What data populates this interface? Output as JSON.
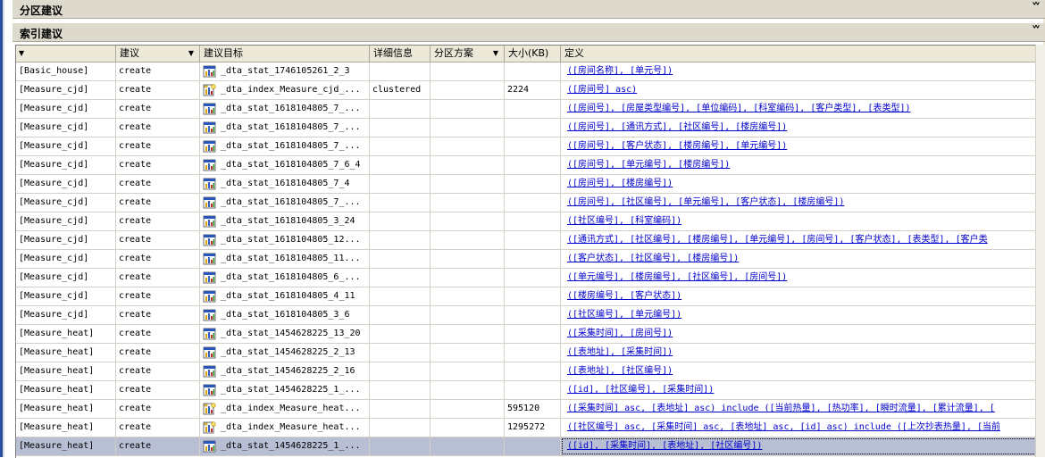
{
  "sections": {
    "partition": {
      "title": "分区建议",
      "chevron": "»"
    },
    "index": {
      "title": "索引建议",
      "chevron": "»"
    }
  },
  "columns": [
    {
      "label": "",
      "sort_icon": "▼"
    },
    {
      "label": "建议",
      "sort_icon": "▼"
    },
    {
      "label": "建议目标",
      "sort_icon": ""
    },
    {
      "label": "详细信息",
      "sort_icon": ""
    },
    {
      "label": "分区方案",
      "sort_icon": "▼"
    },
    {
      "label": "大小(KB)",
      "sort_icon": ""
    },
    {
      "label": "定义",
      "sort_icon": ""
    }
  ],
  "rows": [
    {
      "table": "[Basic_house]",
      "action": "create",
      "icon": "statistics-icon",
      "target": "_dta_stat_1746105261_2_3",
      "detail": "",
      "scheme": "",
      "size": "",
      "definition": "([房间名称], [单元号])",
      "selected": false
    },
    {
      "table": "[Measure_cjd]",
      "action": "create",
      "icon": "index-icon",
      "target": "_dta_index_Measure_cjd_...",
      "detail": "clustered",
      "scheme": "",
      "size": "2224",
      "definition": "([房间号] asc)",
      "selected": false
    },
    {
      "table": "[Measure_cjd]",
      "action": "create",
      "icon": "statistics-icon",
      "target": "_dta_stat_1618104805_7_...",
      "detail": "",
      "scheme": "",
      "size": "",
      "definition": "([房间号], [房屋类型编号], [单位编码], [科室编码], [客户类型], [表类型])",
      "selected": false
    },
    {
      "table": "[Measure_cjd]",
      "action": "create",
      "icon": "statistics-icon",
      "target": "_dta_stat_1618104805_7_...",
      "detail": "",
      "scheme": "",
      "size": "",
      "definition": "([房间号], [通讯方式], [社区编号], [楼房编号])",
      "selected": false
    },
    {
      "table": "[Measure_cjd]",
      "action": "create",
      "icon": "statistics-icon",
      "target": "_dta_stat_1618104805_7_...",
      "detail": "",
      "scheme": "",
      "size": "",
      "definition": "([房间号], [客户状态], [楼房编号], [单元编号])",
      "selected": false
    },
    {
      "table": "[Measure_cjd]",
      "action": "create",
      "icon": "statistics-icon",
      "target": "_dta_stat_1618104805_7_6_4",
      "detail": "",
      "scheme": "",
      "size": "",
      "definition": "([房间号], [单元编号], [楼房编号])",
      "selected": false
    },
    {
      "table": "[Measure_cjd]",
      "action": "create",
      "icon": "statistics-icon",
      "target": "_dta_stat_1618104805_7_4",
      "detail": "",
      "scheme": "",
      "size": "",
      "definition": "([房间号], [楼房编号])",
      "selected": false
    },
    {
      "table": "[Measure_cjd]",
      "action": "create",
      "icon": "statistics-icon",
      "target": "_dta_stat_1618104805_7_...",
      "detail": "",
      "scheme": "",
      "size": "",
      "definition": "([房间号], [社区编号], [单元编号], [客户状态], [楼房编号])",
      "selected": false
    },
    {
      "table": "[Measure_cjd]",
      "action": "create",
      "icon": "statistics-icon",
      "target": "_dta_stat_1618104805_3_24",
      "detail": "",
      "scheme": "",
      "size": "",
      "definition": "([社区编号], [科室编码])",
      "selected": false
    },
    {
      "table": "[Measure_cjd]",
      "action": "create",
      "icon": "statistics-icon",
      "target": "_dta_stat_1618104805_12...",
      "detail": "",
      "scheme": "",
      "size": "",
      "definition": "([通讯方式], [社区编号], [楼房编号], [单元编号], [房间号], [客户状态], [表类型], [客户类",
      "selected": false
    },
    {
      "table": "[Measure_cjd]",
      "action": "create",
      "icon": "statistics-icon",
      "target": "_dta_stat_1618104805_11...",
      "detail": "",
      "scheme": "",
      "size": "",
      "definition": "([客户状态], [社区编号], [楼房编号])",
      "selected": false
    },
    {
      "table": "[Measure_cjd]",
      "action": "create",
      "icon": "statistics-icon",
      "target": "_dta_stat_1618104805_6_...",
      "detail": "",
      "scheme": "",
      "size": "",
      "definition": "([单元编号], [楼房编号], [社区编号], [房间号])",
      "selected": false
    },
    {
      "table": "[Measure_cjd]",
      "action": "create",
      "icon": "statistics-icon",
      "target": "_dta_stat_1618104805_4_11",
      "detail": "",
      "scheme": "",
      "size": "",
      "definition": "([楼房编号], [客户状态])",
      "selected": false
    },
    {
      "table": "[Measure_cjd]",
      "action": "create",
      "icon": "statistics-icon",
      "target": "_dta_stat_1618104805_3_6",
      "detail": "",
      "scheme": "",
      "size": "",
      "definition": "([社区编号], [单元编号])",
      "selected": false
    },
    {
      "table": "[Measure_heat]",
      "action": "create",
      "icon": "statistics-icon",
      "target": "_dta_stat_1454628225_13_20",
      "detail": "",
      "scheme": "",
      "size": "",
      "definition": "([采集时间], [房间号])",
      "selected": false
    },
    {
      "table": "[Measure_heat]",
      "action": "create",
      "icon": "statistics-icon",
      "target": "_dta_stat_1454628225_2_13",
      "detail": "",
      "scheme": "",
      "size": "",
      "definition": "([表地址], [采集时间])",
      "selected": false
    },
    {
      "table": "[Measure_heat]",
      "action": "create",
      "icon": "statistics-icon",
      "target": "_dta_stat_1454628225_2_16",
      "detail": "",
      "scheme": "",
      "size": "",
      "definition": "([表地址], [社区编号])",
      "selected": false
    },
    {
      "table": "[Measure_heat]",
      "action": "create",
      "icon": "statistics-icon",
      "target": "_dta_stat_1454628225_1_...",
      "detail": "",
      "scheme": "",
      "size": "",
      "definition": "([id], [社区编号], [采集时间])",
      "selected": false
    },
    {
      "table": "[Measure_heat]",
      "action": "create",
      "icon": "index-icon",
      "target": "_dta_index_Measure_heat...",
      "detail": "",
      "scheme": "",
      "size": "595120",
      "definition": "([采集时间] asc, [表地址] asc) include ([当前热量], [热功率], [瞬时流量], [累计流量], [",
      "selected": false
    },
    {
      "table": "[Measure_heat]",
      "action": "create",
      "icon": "index-icon",
      "target": "_dta_index_Measure_heat...",
      "detail": "",
      "scheme": "",
      "size": "1295272",
      "definition": "([社区编号] asc, [采集时间] asc, [表地址] asc, [id] asc) include ([上次抄表热量], [当前",
      "selected": false
    },
    {
      "table": "[Measure_heat]",
      "action": "create",
      "icon": "statistics-icon",
      "target": "_dta_stat_1454628225_1_...",
      "detail": "",
      "scheme": "",
      "size": "",
      "definition": "([id], [采集时间], [表地址], [社区编号])",
      "selected": true
    }
  ]
}
